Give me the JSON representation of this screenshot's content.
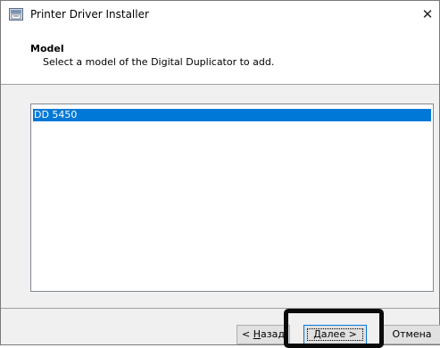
{
  "window": {
    "title": "Printer Driver Installer",
    "close_glyph": "✕",
    "icon": "printer-app-icon"
  },
  "header": {
    "title": "Model",
    "subtitle": "Select a model of the Digital Duplicator to add."
  },
  "model_list": {
    "items": [
      {
        "label": "DD 5450",
        "selected": true
      }
    ]
  },
  "buttons": {
    "back_prefix": "< ",
    "back_accel": "Н",
    "back_rest": "азад",
    "next_accel": "Д",
    "next_rest": "алее >",
    "cancel_label": "Отмена"
  },
  "colors": {
    "selection": "#0078d7",
    "highlight_outline": "#0a0a0a"
  }
}
